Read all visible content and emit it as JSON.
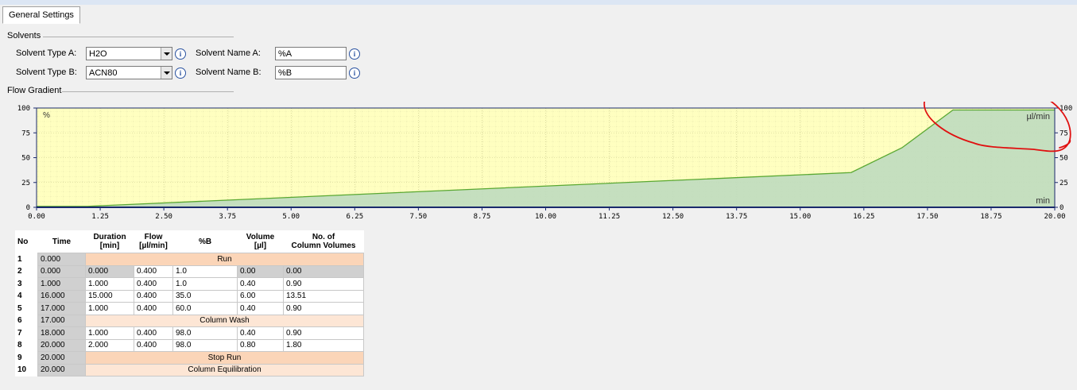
{
  "tab": {
    "label": "General Settings"
  },
  "solvents": {
    "group_label": "Solvents",
    "type_a_label": "Solvent Type A:",
    "type_a_value": "H2O",
    "type_b_label": "Solvent Type B:",
    "type_b_value": "ACN80",
    "name_a_label": "Solvent Name A:",
    "name_a_value": "%A",
    "name_b_label": "Solvent Name B:",
    "name_b_value": "%B",
    "info_glyph": "i"
  },
  "flow_gradient": {
    "group_label": "Flow Gradient"
  },
  "chart_data": {
    "type": "area",
    "left_unit_label": "%",
    "right_unit_label": "µl/min",
    "x_unit_label": "min",
    "x_ticks": [
      "0.00",
      "1.25",
      "2.50",
      "3.75",
      "5.00",
      "6.25",
      "7.50",
      "8.75",
      "10.00",
      "11.25",
      "12.50",
      "13.75",
      "15.00",
      "16.25",
      "17.50",
      "18.75",
      "20.00"
    ],
    "y_left_ticks": [
      "100",
      "75",
      "50",
      "25",
      "0"
    ],
    "y_right_ticks": [
      "100",
      "75",
      "50",
      "25",
      "0"
    ],
    "xlim": [
      0,
      20
    ],
    "ylim": [
      0,
      100
    ],
    "series": [
      {
        "x": [
          0,
          1,
          16,
          17,
          18,
          20
        ],
        "y": [
          1,
          1,
          35,
          60,
          98,
          98
        ]
      }
    ],
    "colors": {
      "above": "#ffffc0",
      "below": "#bfdcbf",
      "line": "#5aa832",
      "axis": "#1a2a6c"
    },
    "annotation": {
      "shape": "freehand-circle",
      "color": "#e01010"
    }
  },
  "table": {
    "headers": [
      "No",
      "Time",
      "Duration\n[min]",
      "Flow\n[µl/min]",
      "%B",
      "Volume\n[µl]",
      "No. of\nColumn Volumes"
    ],
    "rows": [
      {
        "no": "1",
        "time": "0.000",
        "span": "Run",
        "style": "dark"
      },
      {
        "no": "2",
        "time": "0.000",
        "cells": [
          "0.000",
          "0.400",
          "1.0",
          "0.00",
          "0.00"
        ],
        "grey": [
          0,
          3,
          4
        ]
      },
      {
        "no": "3",
        "time": "1.000",
        "cells": [
          "1.000",
          "0.400",
          "1.0",
          "0.40",
          "0.90"
        ]
      },
      {
        "no": "4",
        "time": "16.000",
        "cells": [
          "15.000",
          "0.400",
          "35.0",
          "6.00",
          "13.51"
        ]
      },
      {
        "no": "5",
        "time": "17.000",
        "cells": [
          "1.000",
          "0.400",
          "60.0",
          "0.40",
          "0.90"
        ]
      },
      {
        "no": "6",
        "time": "17.000",
        "span": "Column Wash",
        "style": "light"
      },
      {
        "no": "7",
        "time": "18.000",
        "cells": [
          "1.000",
          "0.400",
          "98.0",
          "0.40",
          "0.90"
        ]
      },
      {
        "no": "8",
        "time": "20.000",
        "cells": [
          "2.000",
          "0.400",
          "98.0",
          "0.80",
          "1.80"
        ]
      },
      {
        "no": "9",
        "time": "20.000",
        "span": "Stop Run",
        "style": "dark"
      },
      {
        "no": "10",
        "time": "20.000",
        "span": "Column Equilibration",
        "style": "light"
      }
    ]
  }
}
